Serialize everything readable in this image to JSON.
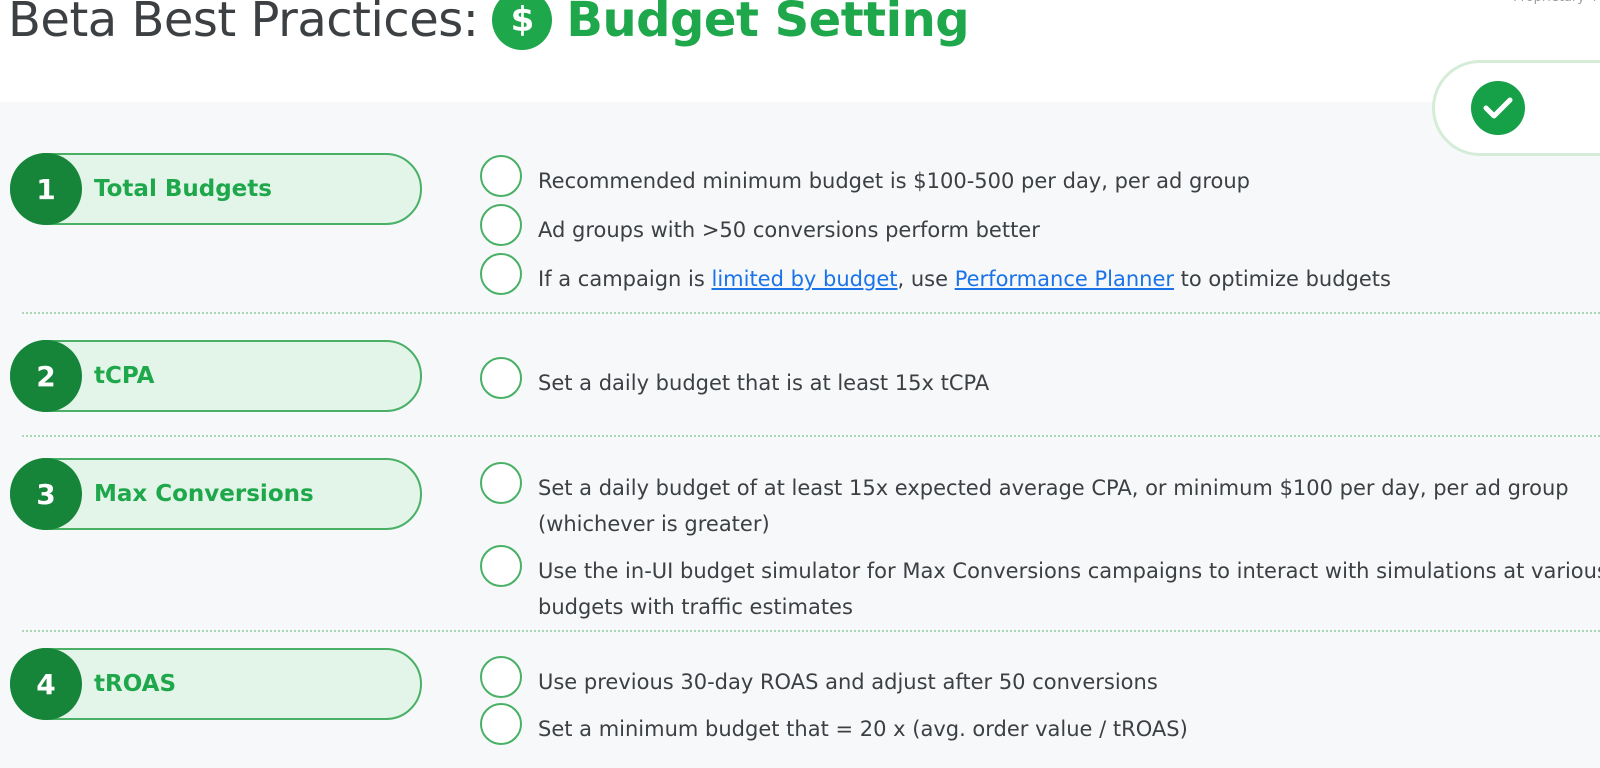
{
  "header": {
    "title_prefix": "Beta Best Practices:",
    "title_icon": "dollar-icon",
    "title_icon_glyph": "$",
    "title_main": "Budget Setting",
    "proprietary_label": "Proprietary +"
  },
  "legend": {
    "icon": "checkmark-icon"
  },
  "colors": {
    "brand_green": "#1fa74b",
    "dark_green": "#16853a",
    "pill_fill": "#e3f5e8",
    "link_blue": "#1a73e8",
    "text_gray": "#3c4043",
    "panel_bg": "#f7f8fa"
  },
  "sections": [
    {
      "number": "1",
      "label": "Total Budgets",
      "items": [
        {
          "text": "Recommended minimum budget is $100-500 per day, per ad group"
        },
        {
          "text": "Ad groups with >50 conversions perform better"
        },
        {
          "text_before": "If a campaign is ",
          "link1": "limited by budget",
          "text_middle": ", use ",
          "link2": "Performance Planner",
          "text_after": " to optimize budgets"
        }
      ]
    },
    {
      "number": "2",
      "label": "tCPA",
      "items": [
        {
          "text": "Set a daily budget that is at least 15x tCPA"
        }
      ]
    },
    {
      "number": "3",
      "label": "Max Conversions",
      "items": [
        {
          "text": "Set a daily budget of at least 15x expected average CPA, or minimum $100 per day, per ad group (whichever is greater)"
        },
        {
          "text": "Use the in-UI budget simulator for Max Conversions campaigns to interact with simulations at various budgets with traffic estimates"
        }
      ]
    },
    {
      "number": "4",
      "label": "tROAS",
      "items": [
        {
          "text": "Use previous 30-day ROAS and adjust after 50 conversions"
        },
        {
          "text": "Set a minimum budget that = 20 x (avg. order value / tROAS)"
        }
      ]
    }
  ]
}
